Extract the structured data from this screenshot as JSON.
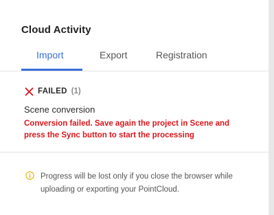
{
  "panel": {
    "title": "Cloud Activity"
  },
  "tabs": [
    {
      "label": "Import",
      "active": true
    },
    {
      "label": "Export",
      "active": false
    },
    {
      "label": "Registration",
      "active": false
    }
  ],
  "status_group": {
    "icon": "close-icon",
    "label": "FAILED",
    "count": "(1)"
  },
  "job": {
    "name": "Scene conversion",
    "error": "Conversion failed. Save again the project in Scene and press the Sync button to start the processing"
  },
  "info": {
    "icon": "info-icon",
    "text": "Progress will be lost only if you close the browser while uploading or exporting your PointCloud."
  },
  "colors": {
    "accent": "#3a6fd8",
    "error": "#d9161b",
    "info_icon": "#e0b100"
  }
}
